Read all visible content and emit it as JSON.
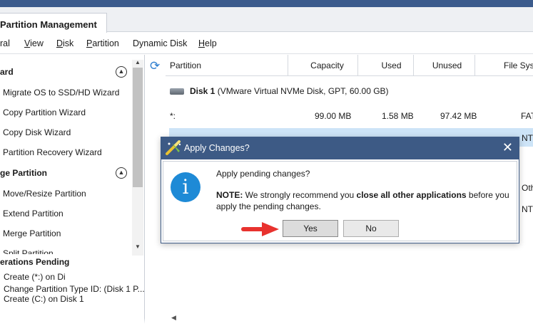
{
  "window": {
    "tab_title": "Partition Management"
  },
  "menu": {
    "items": [
      {
        "prefix": "",
        "key": "",
        "rest": "ral"
      },
      {
        "prefix": "",
        "key": "V",
        "rest": "iew"
      },
      {
        "prefix": "",
        "key": "D",
        "rest": "isk"
      },
      {
        "prefix": "",
        "key": "P",
        "rest": "artition"
      },
      {
        "prefix": "Dynamic Disk",
        "key": "",
        "rest": ""
      },
      {
        "prefix": "",
        "key": "H",
        "rest": "elp"
      }
    ]
  },
  "sidebar": {
    "wizard_title": "ard",
    "wizard_items": [
      "Migrate OS to SSD/HD Wizard",
      "Copy Partition Wizard",
      "Copy Disk Wizard",
      "Partition Recovery Wizard"
    ],
    "partition_title": "ge Partition",
    "partition_items": [
      "Move/Resize Partition",
      "Extend Partition",
      "Merge Partition",
      "Split Partition"
    ],
    "pending_title": "erations Pending",
    "pending_items": [
      "Create (*:) on Di",
      "Change Partition Type ID: (Disk 1 P...",
      "Create (C:) on Disk 1"
    ]
  },
  "table": {
    "columns": [
      "Partition",
      "Capacity",
      "Used",
      "Unused",
      "File Syst"
    ],
    "disk_label": "Disk 1",
    "disk_desc": "(VMware Virtual NVMe Disk, GPT, 60.00 GB)",
    "row1": {
      "partition": "*:",
      "capacity": "99.00 MB",
      "used": "1.58 MB",
      "unused": "97.42 MB",
      "fs": "FAT"
    },
    "row2_fs": "NT",
    "row3_fs": "Oth",
    "row4_fs": "NT"
  },
  "dialog": {
    "title": "Apply Changes?",
    "question": "Apply pending changes?",
    "note_label": "NOTE:",
    "note_pre": " We strongly recommend you ",
    "note_bold": "close all other applications",
    "note_post": " before you apply the pending changes.",
    "yes_label": "Yes",
    "no_label": "No"
  },
  "colors": {
    "dialog_title_bar": "#3d5a85",
    "selection": "#cde4f7",
    "info": "#1e8ad6",
    "arrow": "#e8322e"
  }
}
